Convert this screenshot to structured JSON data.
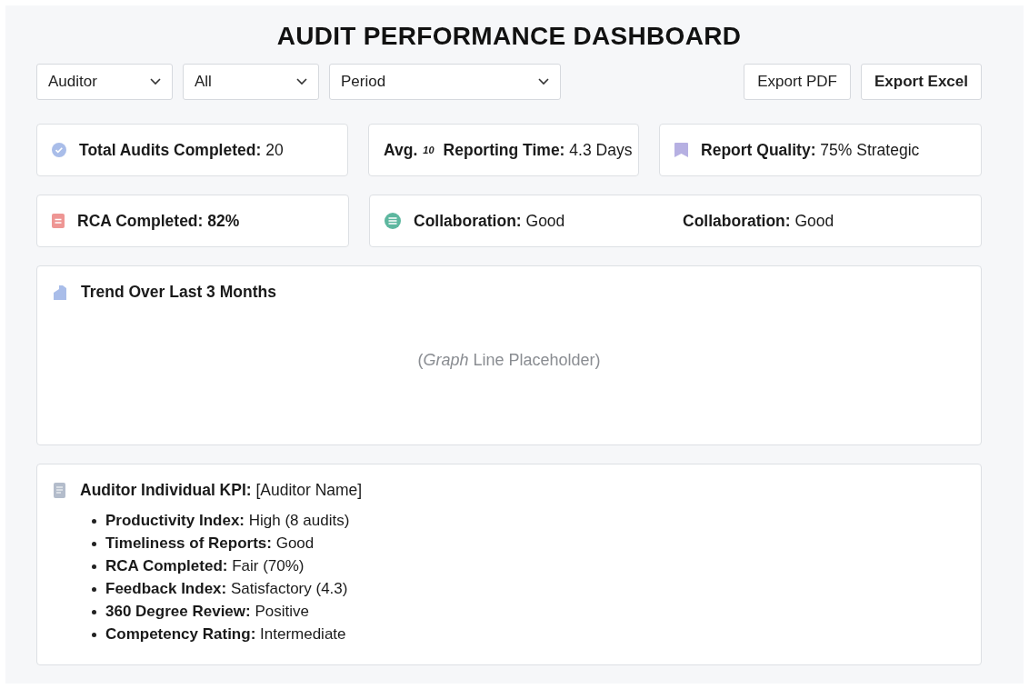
{
  "title": "AUDIT PERFORMANCE DASHBOARD",
  "filters": [
    {
      "value": "Auditor"
    },
    {
      "value": "All"
    },
    {
      "value": "Period"
    }
  ],
  "buttons": [
    {
      "label": "Export PDF",
      "primary": false
    },
    {
      "label": "Export Excel",
      "primary": true
    }
  ],
  "stat_rows": [
    {
      "cards": [
        {
          "items": [
            {
              "kind": "check",
              "text": "**Total Audits Completed:** 20"
            }
          ]
        },
        {
          "items": [
            {
              "kind": "plain",
              "prefix": "Avg.",
              "glyph": "10",
              "text": "**Reporting Time:** 4.3 Days"
            }
          ]
        },
        {
          "items": [
            {
              "kind": "bookmark",
              "text": "**Report Quality:** 75% Strategic"
            }
          ]
        }
      ]
    },
    {
      "cards": [
        {
          "items": [
            {
              "kind": "note",
              "text": "**RCA Completed: 82%**"
            }
          ]
        },
        {
          "items": [
            {
              "kind": "lines",
              "text": "**Collaboration:** Good"
            },
            {
              "kind": "plain",
              "text": "**Collaboration:** Good"
            }
          ]
        }
      ]
    }
  ],
  "trend": {
    "title": "Trend Over Last 3 Months",
    "caption": "(*Graph* Line Placeholder)"
  },
  "kpi": {
    "title": "**Auditor Individual KPI:** [Auditor Name]",
    "items": [
      "**Productivity Index:** High (8 audits)",
      "**Timeliness of Reports:** Good",
      "**RCA Completed:** Fair (70%)",
      "**Feedback Index:** Satisfactory  (4.3)",
      "**360 Degree Review:** Positive",
      "**Competency Rating:** Intermediate"
    ]
  }
}
